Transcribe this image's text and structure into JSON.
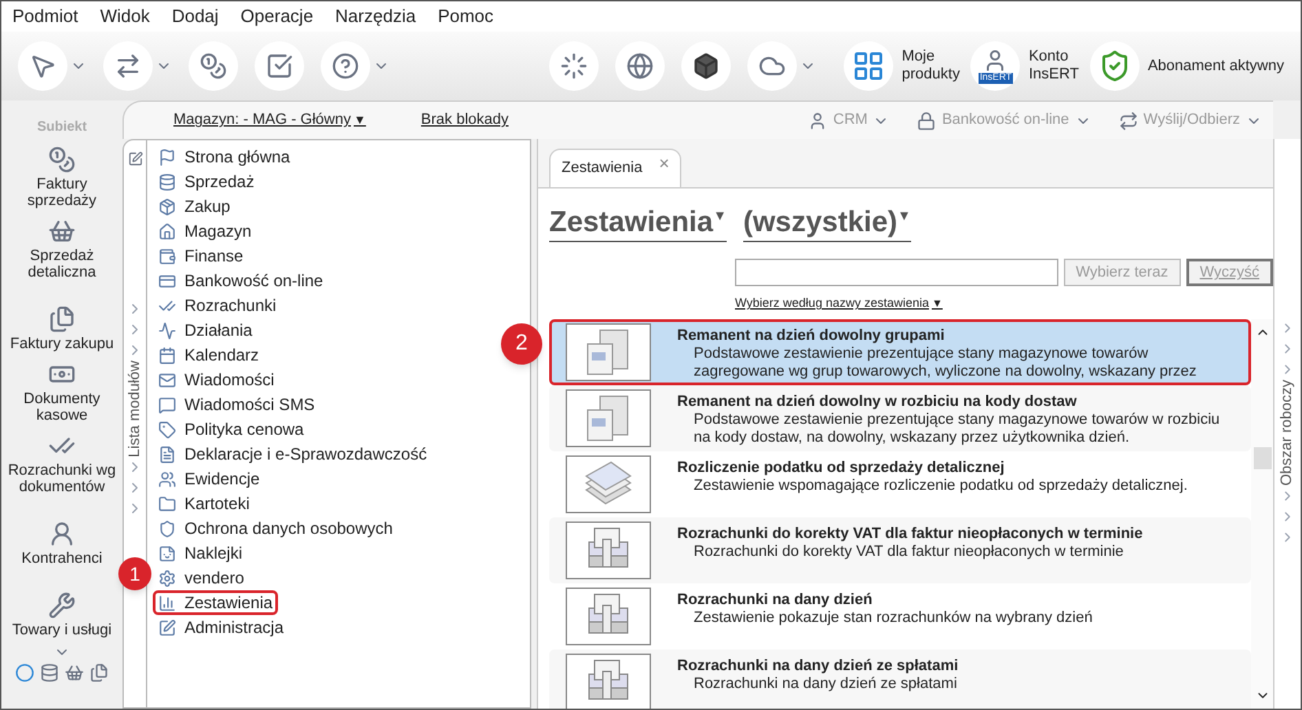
{
  "menu": [
    "Podmiot",
    "Widok",
    "Dodaj",
    "Operacje",
    "Narzędzia",
    "Pomoc"
  ],
  "toolbar": {
    "left_buttons": [
      {
        "kind": "cursor",
        "dropdown": true
      },
      {
        "kind": "arrow",
        "dropdown": true
      },
      {
        "kind": "coins",
        "dropdown": false
      },
      {
        "kind": "check",
        "dropdown": false
      },
      {
        "kind": "help",
        "dropdown": true
      }
    ],
    "right_icons": [
      {
        "kind": "spinner",
        "dropdown": false
      },
      {
        "kind": "globe",
        "dropdown": false
      },
      {
        "kind": "cube",
        "dropdown": false
      },
      {
        "kind": "cloud",
        "dropdown": true
      }
    ],
    "labeled": [
      {
        "kind": "products",
        "label": "Moje\nprodukty"
      },
      {
        "kind": "account",
        "label": "Konto\nInsERT",
        "icon_caption": "InsERT"
      },
      {
        "kind": "shield",
        "label": "Abonament aktywny"
      }
    ]
  },
  "subbar": {
    "warehouse": "Magazyn: - MAG - Główny",
    "warehouse_caret": "▼",
    "lock": "Brak blokady",
    "actions": [
      {
        "kind": "person",
        "label": "CRM"
      },
      {
        "kind": "lock",
        "label": "Bankowość on-line"
      },
      {
        "kind": "exchange",
        "label": "Wyślij/Odbierz"
      }
    ]
  },
  "logo": "Subiekt",
  "sidebar": [
    {
      "label": "Faktury sprzedaży"
    },
    {
      "label": "Sprzedaż detaliczna"
    },
    {
      "label": "Faktury zakupu"
    },
    {
      "label": "Dokumenty kasowe"
    },
    {
      "label": "Rozrachunki wg dokumentów"
    },
    {
      "label": "Kontrahenci"
    },
    {
      "label": "Towary i usługi"
    }
  ],
  "modules_label": "Lista modułów",
  "modules": [
    {
      "label": "Strona główna",
      "highlighted": false
    },
    {
      "label": "Sprzedaż",
      "highlighted": false
    },
    {
      "label": "Zakup",
      "highlighted": false
    },
    {
      "label": "Magazyn",
      "highlighted": false
    },
    {
      "label": "Finanse",
      "highlighted": false
    },
    {
      "label": "Bankowość on-line",
      "highlighted": false
    },
    {
      "label": "Rozrachunki",
      "highlighted": false
    },
    {
      "label": "Działania",
      "highlighted": false
    },
    {
      "label": "Kalendarz",
      "highlighted": false
    },
    {
      "label": "Wiadomości",
      "highlighted": false
    },
    {
      "label": "Wiadomości SMS",
      "highlighted": false
    },
    {
      "label": "Polityka cenowa",
      "highlighted": false
    },
    {
      "label": "Deklaracje i e-Sprawozdawczość",
      "highlighted": false
    },
    {
      "label": "Ewidencje",
      "highlighted": false
    },
    {
      "label": "Kartoteki",
      "highlighted": false
    },
    {
      "label": "Ochrona danych osobowych",
      "highlighted": false
    },
    {
      "label": "Naklejki",
      "highlighted": false
    },
    {
      "label": "vendero",
      "highlighted": false
    },
    {
      "label": "Zestawienia",
      "highlighted": true
    },
    {
      "label": "Administracja",
      "highlighted": false
    }
  ],
  "tab": {
    "label": "Zestawienia",
    "close": "×"
  },
  "heading": {
    "category": "Zestawienia",
    "category_caret": "▼",
    "filter": "(wszystkie)",
    "filter_caret": "▼"
  },
  "search": {
    "choose_button": "Wybierz teraz",
    "choose_disabled": true,
    "clear_button": "Wyczyść",
    "sort_link": "Wybierz według nazwy zestawienia",
    "sort_caret": "▼"
  },
  "reports": [
    {
      "kind": "boxes",
      "title": "Remanent na dzień dowolny grupami",
      "description": "Podstawowe zestawienie prezentujące stany magazynowe towarów zagregowane wg grup towarowych, wyliczone na dowolny, wskazany przez",
      "selected": true,
      "highlighted": true
    },
    {
      "kind": "boxes",
      "title": "Remanent na dzień dowolny w rozbiciu na kody dostaw",
      "description": "Podstawowe zestawienie prezentujące stany magazynowe towarów w rozbiciu na kody dostaw, na dowolny, wskazany przez użytkownika dzień.",
      "selected": false,
      "highlighted": false
    },
    {
      "kind": "sheets",
      "title": "Rozliczenie podatku od sprzedaży detalicznej",
      "description": "Zestawienie wspomagające rozliczenie podatku od sprzedaży detalicznej.",
      "selected": false,
      "highlighted": false
    },
    {
      "kind": "bundle",
      "title": "Rozrachunki do korekty VAT dla faktur nieopłaconych w terminie",
      "description": "Rozrachunki do korekty VAT dla faktur nieopłaconych w terminie",
      "selected": false,
      "highlighted": false
    },
    {
      "kind": "bundle",
      "title": "Rozrachunki na dany dzień",
      "description": "Zestawienie pokazuje stan rozrachunków na wybrany dzień",
      "selected": false,
      "highlighted": false
    },
    {
      "kind": "bundle",
      "title": "Rozrachunki na dany dzień ze spłatami",
      "description": "Rozrachunki na dany dzień ze spłatami",
      "selected": false,
      "highlighted": false
    }
  ],
  "work_area_label": "Obszar roboczy",
  "callouts": [
    {
      "label": "1"
    },
    {
      "label": "2"
    }
  ]
}
